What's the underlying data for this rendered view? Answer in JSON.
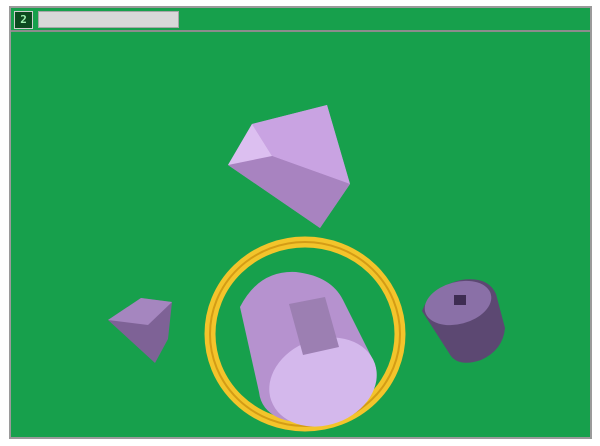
{
  "hud": {
    "level_number": "2",
    "progress_fraction": 1.0
  },
  "scene": {
    "background_color": "#17a04c",
    "shape_color": "#c9a3e2",
    "highlight_ring_color": "#f3c42b",
    "shapes": [
      {
        "name": "cone-cylinder-top",
        "icon": "cone-cylinder-icon"
      },
      {
        "name": "cone-small-left",
        "icon": "cone-icon"
      },
      {
        "name": "cylinder-highlighted-center",
        "icon": "cylinder-icon"
      },
      {
        "name": "cylinder-small-right",
        "icon": "cylinder-notch-icon"
      }
    ]
  }
}
